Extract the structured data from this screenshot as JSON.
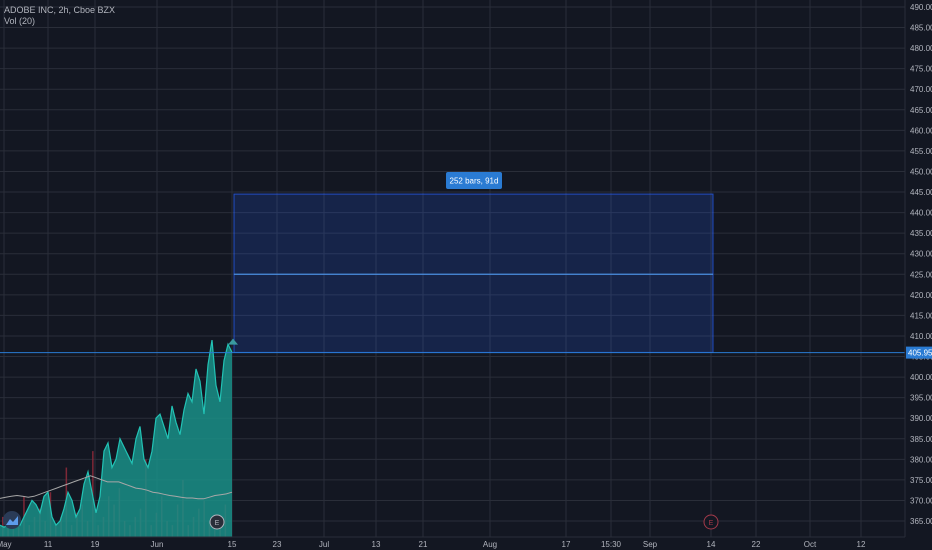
{
  "legend": {
    "symbol": "ADOBE INC, 2h, Cboe BZX",
    "indicator": "Vol (20)"
  },
  "colors": {
    "background": "#131722",
    "grid": "#2a2e39",
    "axis_text": "#b2b5be",
    "area_fill": "#1a8f87",
    "area_line": "#22c3b5",
    "volume_bars": "#8b2a3a",
    "volume_ma": "#a7a7a7",
    "range_box": "#2962ff",
    "range_label_bg": "#2a7bd3",
    "price_label_bg": "#2a7bd3"
  },
  "chart_data": {
    "type": "area",
    "title": "ADOBE INC, 2h, Cboe BZX",
    "y_axis": {
      "range": [
        363,
        491
      ],
      "ticks": [
        490,
        485,
        480,
        475,
        470,
        465,
        460,
        455,
        450,
        445,
        440,
        435,
        430,
        425,
        420,
        415,
        410,
        405,
        400,
        395,
        390,
        385,
        380,
        375,
        370,
        365
      ],
      "tick_labels": [
        "490.00",
        "485.00",
        "480.00",
        "475.00",
        "470.00",
        "465.00",
        "460.00",
        "455.00",
        "450.00",
        "445.00",
        "440.00",
        "435.00",
        "430.00",
        "425.00",
        "420.00",
        "415.00",
        "410.00",
        "405.00",
        "400.00",
        "395.00",
        "390.00",
        "385.00",
        "380.00",
        "375.00",
        "370.00",
        "365.00"
      ]
    },
    "x_axis": {
      "tick_labels": [
        "May",
        "11",
        "19",
        "Jun",
        "15",
        "23",
        "Jul",
        "13",
        "21",
        "Aug",
        "17",
        "15:30",
        "Sep",
        "14",
        "22",
        "Oct",
        "12"
      ]
    },
    "grid": true,
    "last_price": 405.95,
    "last_price_label": "405.95",
    "series": [
      {
        "x": [
          0,
          4,
          8,
          12,
          16,
          20,
          24,
          28,
          32,
          36,
          40,
          44,
          48,
          52,
          56,
          60,
          64,
          68,
          72,
          76,
          80,
          84,
          88,
          92,
          96,
          100,
          104,
          108,
          112,
          116,
          120,
          124,
          128,
          132,
          136,
          140,
          144,
          148,
          152,
          156,
          160,
          164,
          168,
          172,
          176,
          180,
          184,
          188,
          192,
          196,
          200,
          204,
          208,
          212,
          216,
          220,
          224,
          228,
          232
        ],
        "values": [
          364,
          363.5,
          364,
          365,
          366,
          364,
          366,
          368,
          370,
          369,
          367,
          371,
          372,
          366,
          364,
          365,
          368,
          372,
          370,
          366,
          368,
          374,
          377,
          372,
          367,
          371,
          382,
          384,
          378,
          380,
          385,
          383,
          381,
          379,
          385,
          388,
          380,
          378,
          382,
          390,
          391,
          388,
          385,
          393,
          389,
          386,
          392,
          396,
          394,
          402,
          399,
          391,
          403,
          409,
          398,
          394,
          404,
          408,
          406
        ]
      }
    ],
    "volume": {
      "name": "Vol (20)",
      "ma_values": [
        370.5,
        370.8,
        371,
        371.2,
        371,
        370.8,
        371,
        371.5,
        372,
        372.5,
        373,
        373.5,
        374,
        374.5,
        375,
        375.5,
        376,
        375.5,
        375,
        374.5,
        374.5,
        374.5,
        374,
        373.5,
        373,
        372.8,
        372.5,
        372,
        371.8,
        371.5,
        371.2,
        371,
        370.8,
        370.6,
        370.6,
        370.4,
        370.4,
        370.8,
        371.2,
        371.4,
        371.6,
        372
      ],
      "bars": [
        366,
        364,
        367,
        365,
        371,
        364,
        366,
        368,
        365,
        372,
        364,
        366,
        378,
        364,
        367,
        369,
        365,
        382,
        364,
        366,
        371,
        369,
        373,
        365,
        364,
        366,
        368,
        380,
        364,
        367,
        371,
        365,
        364,
        369,
        375,
        364,
        366,
        368,
        370,
        365,
        364,
        366,
        369
      ]
    },
    "annotations": {
      "range_box": {
        "price_top": 444.5,
        "price_bottom": 406,
        "price_mid": 425
      },
      "range_label": "252 bars, 91d",
      "earnings_markers": [
        "E",
        "E"
      ]
    }
  }
}
